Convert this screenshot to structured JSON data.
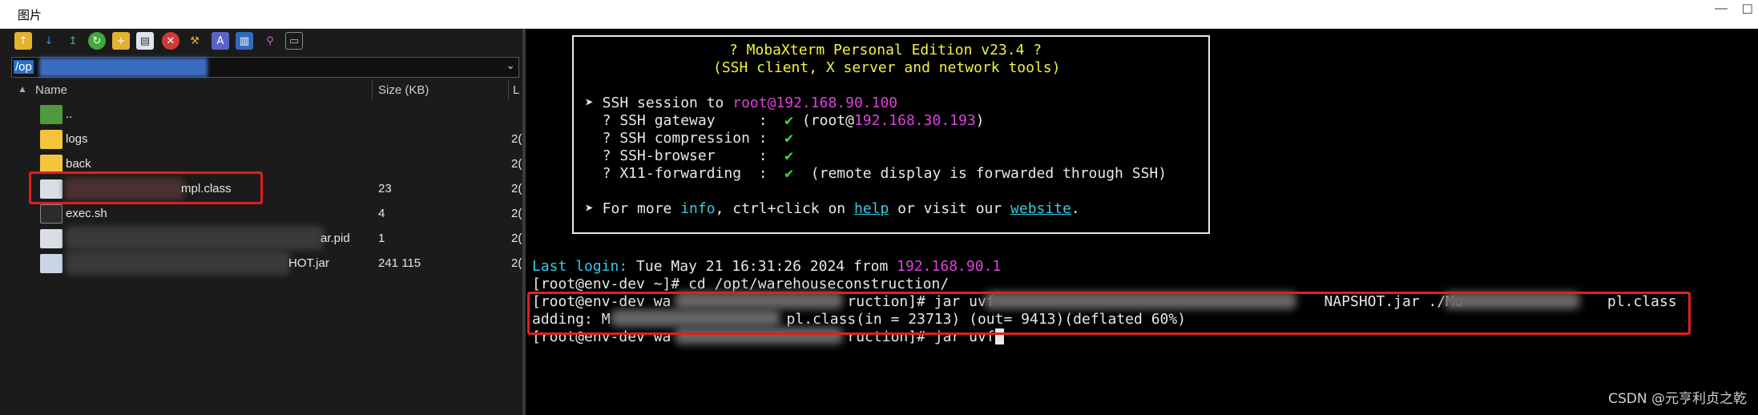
{
  "window": {
    "title": "图片",
    "minimize_glyph": "—",
    "maximize_glyph": "☐"
  },
  "sftp": {
    "toolbar_icons": [
      "folder-up-icon",
      "download-icon",
      "upload-icon",
      "refresh-icon",
      "new-folder-icon",
      "new-file-icon",
      "delete-icon",
      "settings-icon",
      "text-icon",
      "bookmark-icon",
      "magic-icon",
      "terminal-icon"
    ],
    "path_value": "/op",
    "columns": {
      "name": "Name",
      "size": "Size (KB)",
      "last": "L"
    },
    "files": [
      {
        "name": "..",
        "size": "",
        "date": "",
        "type": "parent"
      },
      {
        "name": "logs",
        "size": "",
        "date": "2(",
        "type": "folder"
      },
      {
        "name": "back",
        "size": "",
        "date": "2(",
        "type": "folder"
      },
      {
        "name": "mpl.class",
        "size": "23",
        "date": "2(",
        "type": "doc"
      },
      {
        "name": "exec.sh",
        "size": "4",
        "date": "2(",
        "type": "term"
      },
      {
        "name": "ar.pid",
        "size": "1",
        "date": "2(",
        "type": "doc"
      },
      {
        "name": "HOT.jar",
        "size": "241 115",
        "date": "2(",
        "type": "jar"
      }
    ]
  },
  "terminal": {
    "banner": {
      "line1": "? MobaXterm Personal Edition v23.4 ?",
      "line2": "(SSH client, X server and network tools)",
      "session_prefix": "➤ SSH session to ",
      "session_host": "root@192.168.90.100",
      "gateway_label": "  ? SSH gateway     :  ",
      "check": "✔",
      "gateway_open": " (root@",
      "gateway_ip": "192.168.30.193",
      "gateway_close": ")",
      "compression_label": "  ? SSH compression :  ",
      "browser_label": "  ? SSH-browser     :  ",
      "x11_label": "  ? X11-forwarding  :  ",
      "x11_note": "  (remote display is forwarded through SSH)",
      "info_prefix": "➤ For more ",
      "info_link": "info",
      "info_mid": ", ctrl+click on ",
      "help_link": "help",
      "info_mid2": " or visit our ",
      "website_link": "website",
      "info_end": "."
    },
    "last_login_label": "Last login:",
    "last_login_text": " Tue May 21 16:31:26 2024 from ",
    "last_login_ip": "192.168.90.1",
    "line_cd": "[root@env-dev ~]# cd /opt/warehouseconstruction/",
    "line_jar_a": "[root@env-dev wa",
    "line_jar_b": "ruction]# jar uvf ",
    "line_jar_c": "NAPSHOT.jar ./Mo",
    "line_jar_d": "pl.class",
    "line_adding_a": "adding: M",
    "line_adding_b": "pl.class(in = 23713) (out= 9413)(deflated 60%)",
    "line_prompt_a": "[root@env-dev wa",
    "line_prompt_b": "ruction]# jar uvf"
  },
  "watermark": "CSDN @元亨利贞之乾",
  "colors": {
    "accent_red": "#e02020",
    "magenta": "#e040e0",
    "yellow": "#f2f23a",
    "cyan": "#39c8e6",
    "green": "#3adf3a"
  }
}
